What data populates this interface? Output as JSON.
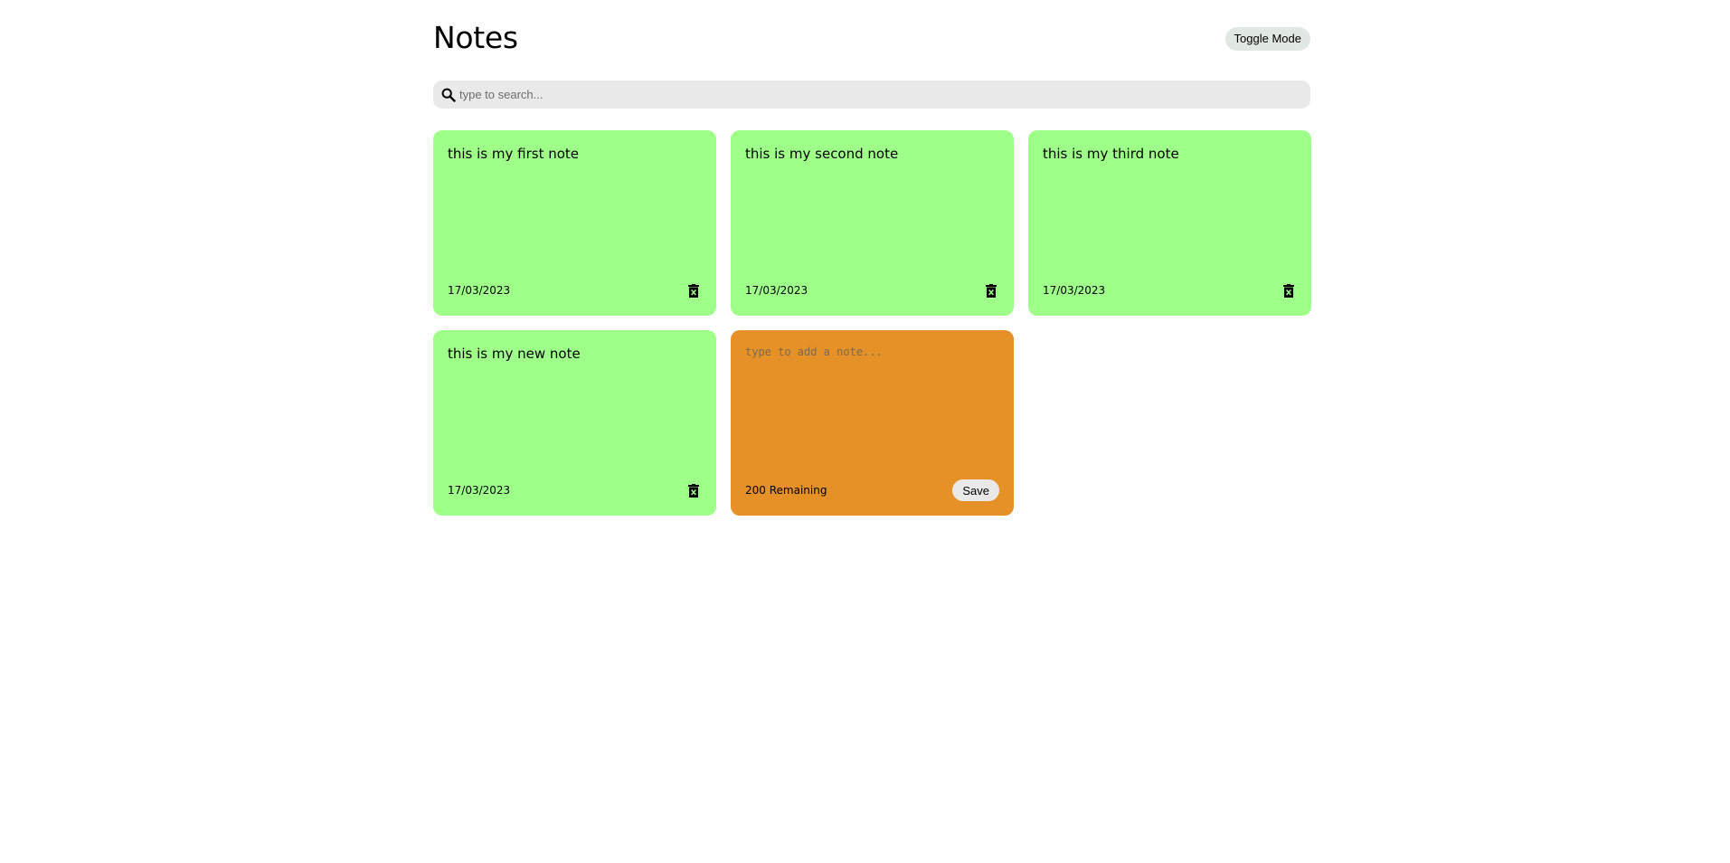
{
  "header": {
    "title": "Notes",
    "toggle_label": "Toggle Mode"
  },
  "search": {
    "icon": "search-icon",
    "placeholder": "type to search...",
    "value": ""
  },
  "notes": [
    {
      "text": "this is my first note",
      "date": "17/03/2023"
    },
    {
      "text": "this is my second note",
      "date": "17/03/2023"
    },
    {
      "text": "this is my third note",
      "date": "17/03/2023"
    },
    {
      "text": "this is my new note",
      "date": "17/03/2023"
    }
  ],
  "add_note": {
    "placeholder": "type to add a note...",
    "value": "",
    "remaining": "200 Remaining",
    "save_label": "Save"
  },
  "colors": {
    "note_bg": "#9eff89",
    "add_note_bg": "#e59128",
    "search_bg": "#e9e9e9",
    "toggle_bg": "#e1e7e1"
  }
}
